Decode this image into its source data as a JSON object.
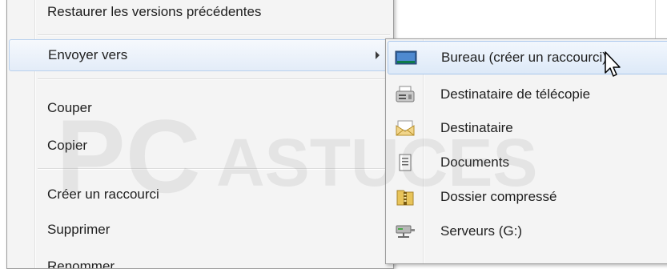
{
  "context_menu": {
    "items": [
      {
        "label": "Restaurer les versions précédentes"
      },
      {
        "label": "Envoyer vers"
      },
      {
        "label": "Couper"
      },
      {
        "label": "Copier"
      },
      {
        "label": "Créer un raccourci"
      },
      {
        "label": "Supprimer"
      },
      {
        "label": "Renommer"
      }
    ]
  },
  "send_to_submenu": {
    "items": [
      {
        "label": "Bureau (créer un raccourci)",
        "icon": "desktop-icon"
      },
      {
        "label": "Destinataire de télécopie",
        "icon": "fax-icon"
      },
      {
        "label": "Destinataire",
        "icon": "mail-recipient-icon"
      },
      {
        "label": "Documents",
        "icon": "documents-icon"
      },
      {
        "label": "Dossier compressé",
        "icon": "zip-folder-icon"
      },
      {
        "label": "Serveurs (G:)",
        "icon": "network-drive-icon"
      }
    ]
  },
  "watermark": {
    "text": "PC ASTUCES"
  },
  "colors": {
    "menu_bg": "#f4f4f4",
    "hover_border": "#a9c7ec",
    "hover_top": "#f2f7fd",
    "hover_bottom": "#dde9f8"
  }
}
